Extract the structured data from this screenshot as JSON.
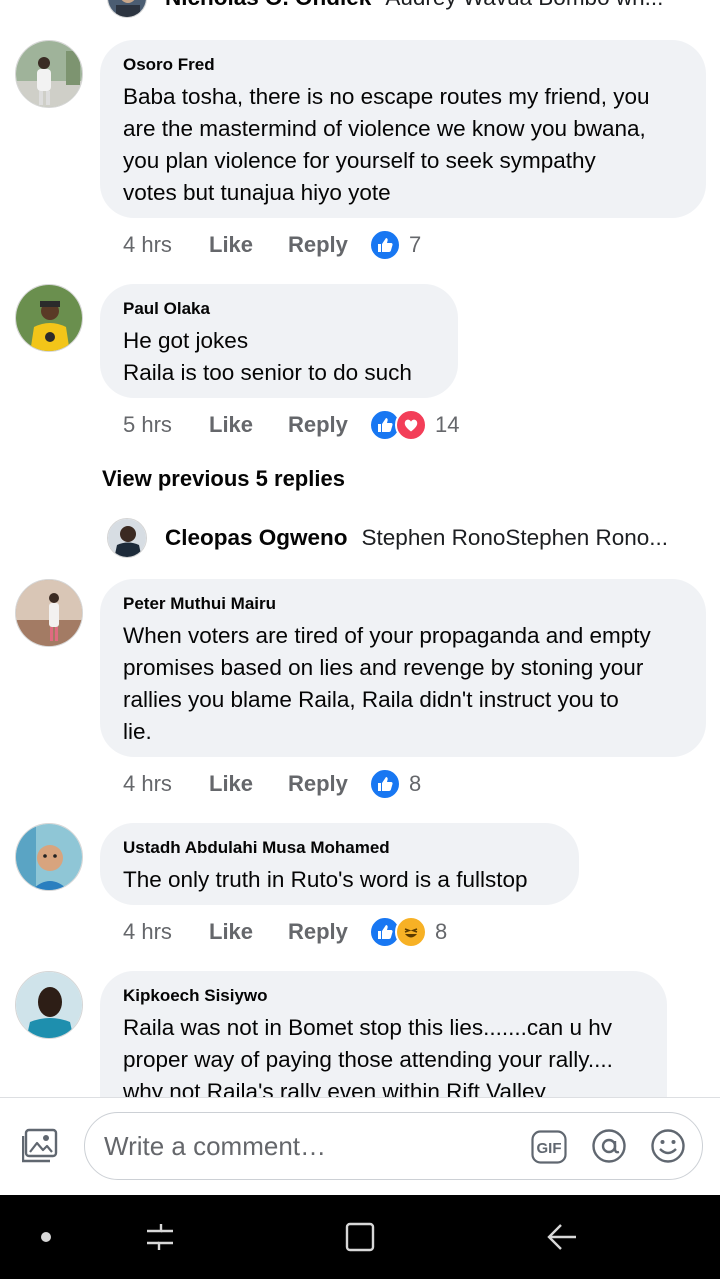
{
  "top_collapsed": {
    "name": "Nicholas O. Ondiek",
    "snippet": "Audrey Wavua Bombo wh..."
  },
  "comments": [
    {
      "author": "Osoro Fred",
      "lines": [
        "Baba tosha, there is no escape routes my friend, you",
        "are the mastermind of violence we know you bwana,",
        "you plan violence for yourself to seek sympathy",
        "votes but tunajua hiyo yote"
      ],
      "time": "4 hrs",
      "like": "Like",
      "reply": "Reply",
      "reactions": [
        "like"
      ],
      "count": "7"
    },
    {
      "author": "Paul Olaka",
      "lines": [
        "He got jokes",
        "Raila is too senior to do such"
      ],
      "time": "5 hrs",
      "like": "Like",
      "reply": "Reply",
      "reactions": [
        "like",
        "love"
      ],
      "count": "14"
    },
    {
      "author": "Peter Muthui Mairu",
      "lines": [
        "When voters are tired of your propaganda and empty",
        "promises based on lies and revenge by stoning your",
        "rallies you blame Raila, Raila didn't instruct you to",
        "lie."
      ],
      "time": "4 hrs",
      "like": "Like",
      "reply": "Reply",
      "reactions": [
        "like"
      ],
      "count": "8"
    },
    {
      "author": "Ustadh Abdulahi Musa Mohamed",
      "lines": [
        "The only truth in Ruto's word is a fullstop"
      ],
      "time": "4 hrs",
      "like": "Like",
      "reply": "Reply",
      "reactions": [
        "like",
        "haha"
      ],
      "count": "8"
    },
    {
      "author": "Kipkoech Sisiywo",
      "lines": [
        "Raila was not in Bomet stop this lies.......can u hv",
        "proper way of paying those attending your rally....",
        "why not Raila's rally even within Rift Valley"
      ]
    }
  ],
  "view_previous": "View previous 5 replies",
  "reply_collapsed": {
    "name": "Cleopas Ogweno",
    "snippet": "Stephen RonoStephen Rono..."
  },
  "composer": {
    "placeholder": "Write a comment…",
    "gif_label": "GIF"
  },
  "icons": {
    "photo": "photo-icon",
    "gif": "gif-icon",
    "mention": "at-icon",
    "emoji": "emoji-icon",
    "nav_dot": "dot-icon",
    "nav_recents": "recents-icon",
    "nav_home": "home-square-icon",
    "nav_back": "back-arrow-icon"
  },
  "colors": {
    "bubble": "#f0f2f5",
    "meta": "#65676b",
    "like_blue": "#1877f2",
    "love_red": "#f33e58",
    "haha_yellow": "#f7b125"
  }
}
